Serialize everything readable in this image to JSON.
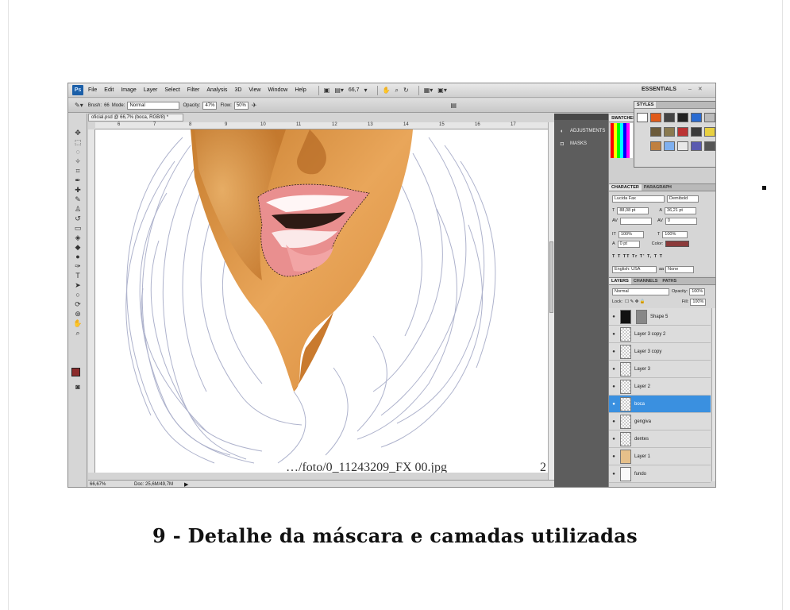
{
  "menubar": {
    "app_logo": "Ps",
    "items": [
      "File",
      "Edit",
      "Image",
      "Layer",
      "Select",
      "Filter",
      "Analysis",
      "3D",
      "View",
      "Window",
      "Help"
    ],
    "zoom": "66,7",
    "workspace": "ESSENTIALS",
    "window_controls": "– ✕"
  },
  "options_bar": {
    "brush_label": "Brush:",
    "brush_size": "66",
    "mode_label": "Mode:",
    "mode_value": "Normal",
    "opacity_label": "Opacity:",
    "opacity_value": "47%",
    "flow_label": "Flow:",
    "flow_value": "50%"
  },
  "document": {
    "tab_title": "oficial.psd @ 66,7% (boca, RGB/8) *",
    "ruler_numbers": [
      "6",
      "7",
      "8",
      "9",
      "10",
      "11",
      "12",
      "13",
      "14",
      "15",
      "16",
      "17"
    ],
    "status_zoom": "66,67%",
    "status_doc": "Doc: 25,6M/49,7M",
    "canvas_partial_text": "…/foto/0_11243209_FX 00.jpg",
    "canvas_corner_text": "2"
  },
  "dock": {
    "items": [
      {
        "label": "ADJUSTMENTS",
        "icon": "adjustments-icon"
      },
      {
        "label": "MASKS",
        "icon": "masks-icon"
      }
    ]
  },
  "panels": {
    "styles_tab": "STYLES",
    "swatches_tab": "SWATCHES",
    "character": {
      "tabs": [
        "CHARACTER",
        "PARAGRAPH"
      ],
      "font_family": "Lucida Fax",
      "font_style": "Demibold",
      "font_size": "88,08 pt",
      "leading": "36,21 pt",
      "tracking": "0",
      "vertical_scale": "100%",
      "horizontal_scale": "100%",
      "baseline_shift": "0 pt",
      "color_label": "Color:",
      "color_value": "#8b3a3a",
      "style_buttons": "T T TT Tr T' T, T T",
      "language": "English: USA",
      "antialias": "None"
    },
    "layers": {
      "tabs": [
        "LAYERS",
        "CHANNELS",
        "PATHS"
      ],
      "blend_mode": "Normal",
      "opacity_label": "Opacity:",
      "opacity_value": "100%",
      "lock_label": "Lock:",
      "fill_label": "Fill:",
      "fill_value": "100%",
      "items": [
        {
          "name": "Shape 5"
        },
        {
          "name": "Layer 3 copy 2"
        },
        {
          "name": "Layer 3 copy"
        },
        {
          "name": "Layer 3"
        },
        {
          "name": "Layer 2"
        },
        {
          "name": "boca"
        },
        {
          "name": "gengiva"
        },
        {
          "name": "dentes"
        },
        {
          "name": "Layer 1"
        },
        {
          "name": "fundo"
        }
      ],
      "selected_index": 5
    }
  },
  "caption": "9 - Detalhe da máscara e camadas utilizadas"
}
